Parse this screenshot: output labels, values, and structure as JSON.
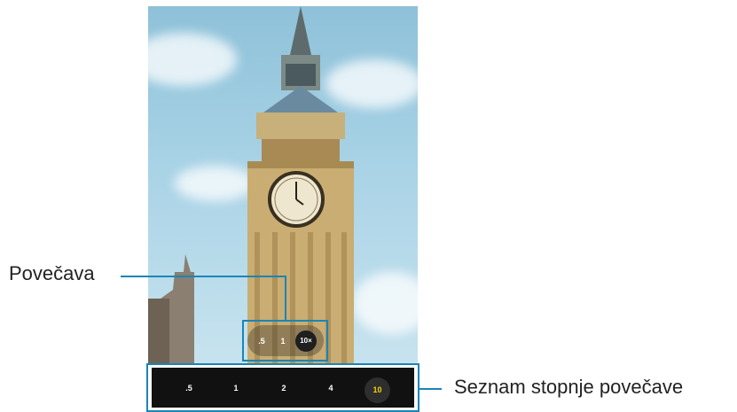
{
  "screenshot": {
    "zoom_control": {
      "options": [
        ".5",
        "1"
      ],
      "active": "10×"
    },
    "zoom_level_list": {
      "options": [
        ".5",
        "1",
        "2",
        "4"
      ],
      "active": "10"
    },
    "labels": {
      "zoom": "Povečava",
      "zoom_level_list": "Seznam stopnje povečave"
    },
    "colors": {
      "callout": "#1a85b8",
      "active_zoom_text": "#f2d400",
      "bar_background": "#111111"
    }
  }
}
